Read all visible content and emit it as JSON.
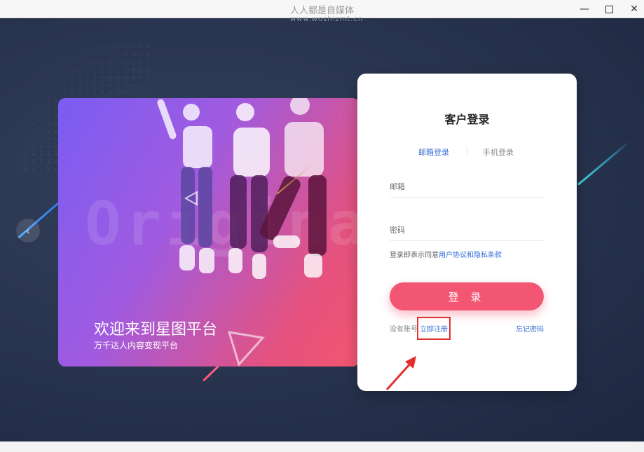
{
  "window": {
    "title": "人人都是自媒体",
    "watermark": "www.woshizmt.cn"
  },
  "hero": {
    "background_word": "Originality",
    "title": "欢迎来到星图平台",
    "subtitle": "万千达人内容变现平台"
  },
  "login": {
    "title": "客户登录",
    "tabs": [
      {
        "label": "邮箱登录",
        "active": true
      },
      {
        "label": "手机登录",
        "active": false
      }
    ],
    "email_placeholder": "邮箱",
    "password_placeholder": "密码",
    "agreement_prefix": "登录即表示同意",
    "agreement_link": "用户协议和隐私条款",
    "submit_label": "登 录",
    "no_account_text": "没有账号",
    "register_label": "立即注册",
    "forgot_label": "忘记密码"
  },
  "colors": {
    "accent_blue": "#3a6fd8",
    "login_button": "#f25673",
    "highlight_box": "#e2302e"
  },
  "icons": {
    "minimize": "minimize-icon",
    "maximize": "maximize-icon",
    "close": "close-icon",
    "carousel_prev": "chevron-left-icon",
    "annotation": "arrow-icon"
  }
}
